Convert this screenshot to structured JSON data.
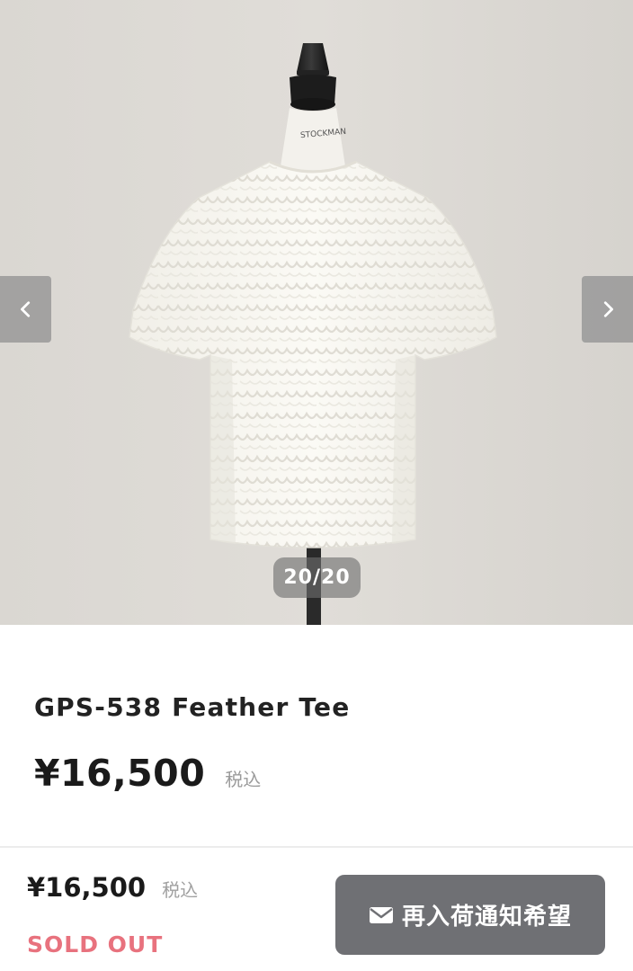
{
  "gallery": {
    "current_slide": 20,
    "total_slides": 20,
    "counter_text": "20/20",
    "mannequin_label": "STOCKMAN",
    "prev_icon": "chevron-left-icon",
    "next_icon": "chevron-right-icon"
  },
  "product": {
    "title": "GPS-538 Feather Tee",
    "price": "¥16,500",
    "tax_label": "税込"
  },
  "purchase_bar": {
    "price": "¥16,500",
    "tax_label": "税込",
    "status": "SOLD OUT",
    "notify_button_label": "再入荷通知希望",
    "notify_icon": "mail-icon"
  },
  "colors": {
    "sold_out": "#e8727e",
    "button_bg": "#6f7074",
    "backdrop": "#dbd8d3"
  }
}
